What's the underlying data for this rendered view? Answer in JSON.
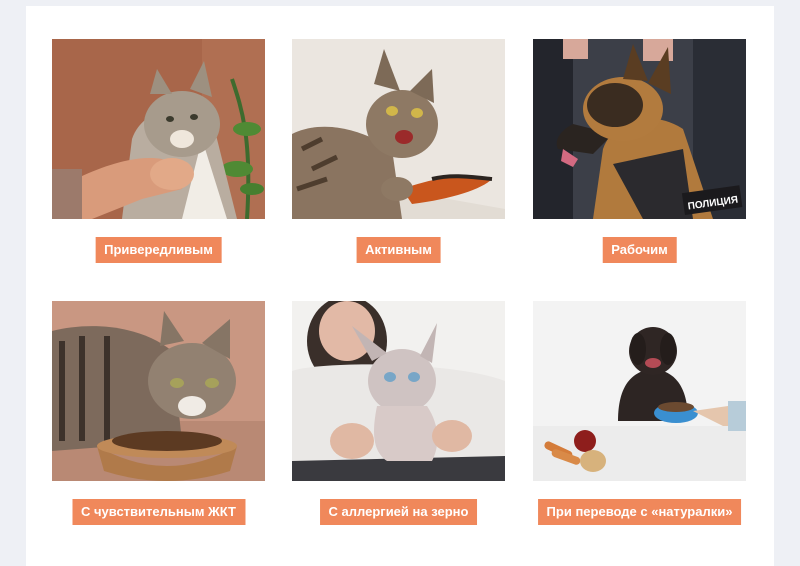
{
  "categories": [
    {
      "label": "Привередливым",
      "image": "picky-cat-eating-from-hand-photo"
    },
    {
      "label": "Активным",
      "image": "active-cat-playing-with-toy-photo"
    },
    {
      "label": "Рабочим",
      "image": "police-dog-in-harness-photo"
    },
    {
      "label": "С чувствительным ЖКТ",
      "image": "cat-eating-dry-food-from-bowl-photo"
    },
    {
      "label": "С аллергией на зерно",
      "image": "sphynx-cat-held-by-woman-photo"
    },
    {
      "label": "При переводе с «натуралки»",
      "image": "dog-with-food-bowl-and-vegetables-photo"
    }
  ],
  "badges": {
    "police_patch": "ПОЛИЦИЯ"
  },
  "colors": {
    "page_background": "#eef0f5",
    "card_background": "#ffffff",
    "tag_background": "#f0885b",
    "tag_text": "#ffffff"
  }
}
